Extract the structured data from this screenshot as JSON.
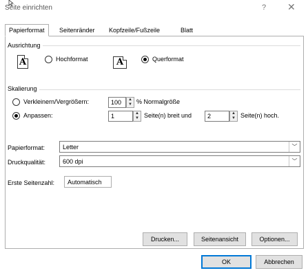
{
  "dialog": {
    "title": "Seite einrichten",
    "help_label": "?",
    "close_label": "✕"
  },
  "tabs": [
    {
      "label": "Papierformat",
      "active": true
    },
    {
      "label": "Seitenränder",
      "active": false
    },
    {
      "label": "Kopfzeile/Fußzeile",
      "active": false
    },
    {
      "label": "Blatt",
      "active": false
    }
  ],
  "orientation": {
    "group_label": "Ausrichtung",
    "portrait_label": "Hochformat",
    "landscape_label": "Querformat",
    "icon_letter": "A",
    "selected": "landscape"
  },
  "scaling": {
    "group_label": "Skalierung",
    "adjust_to_label": "Verkleinern/Vergrößern:",
    "adjust_to_value": "100",
    "adjust_to_suffix": "% Normalgröße",
    "fit_to_label": "Anpassen:",
    "fit_wide_value": "1",
    "fit_wide_suffix": "Seite(n) breit und",
    "fit_tall_value": "2",
    "fit_tall_suffix": "Seite(n) hoch.",
    "selected": "fit"
  },
  "paper": {
    "paper_size_label": "Papierformat:",
    "paper_size_value": "Letter",
    "print_quality_label": "Druckqualität:",
    "print_quality_value": "600 dpi",
    "first_page_label": "Erste Seitenzahl:",
    "first_page_value": "Automatisch"
  },
  "buttons": {
    "print": "Drucken...",
    "preview": "Seitenansicht",
    "options": "Optionen...",
    "ok": "OK",
    "cancel": "Abbrechen"
  }
}
